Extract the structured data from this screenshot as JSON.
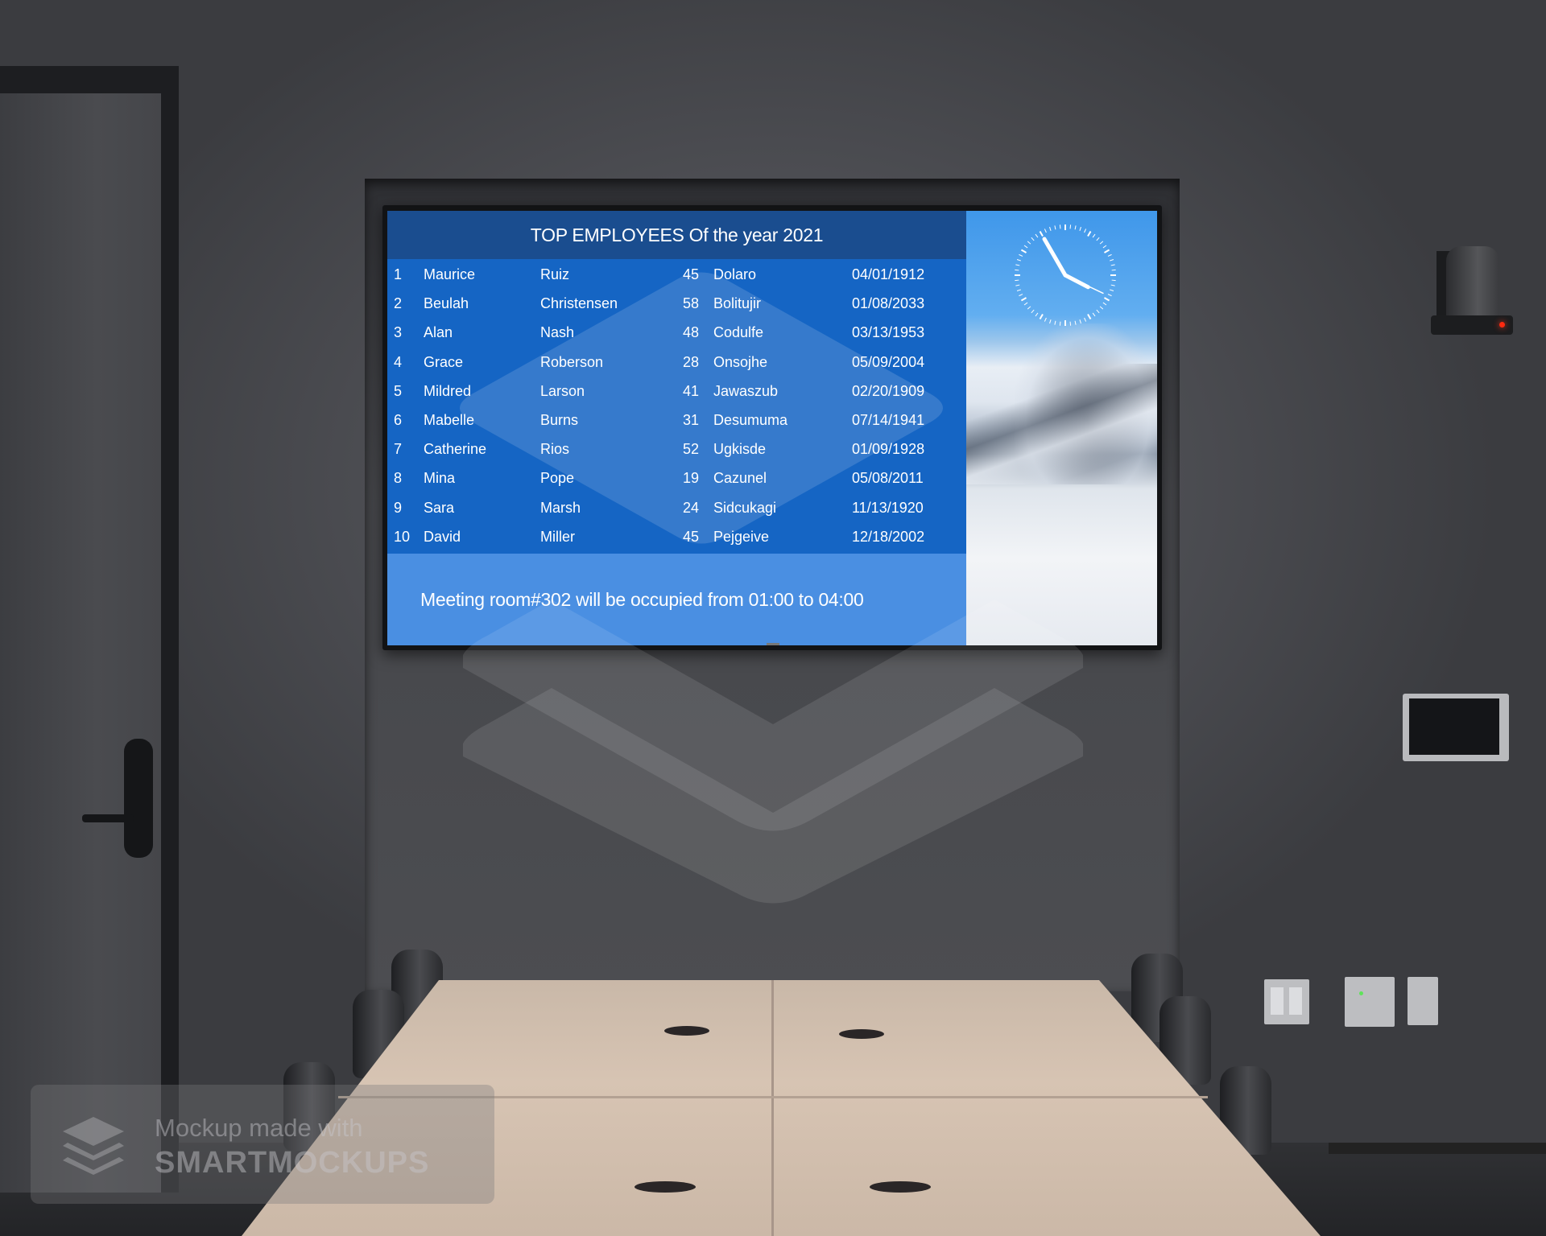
{
  "screen": {
    "title": "TOP EMPLOYEES Of the year 2021",
    "employees": [
      {
        "rank": "1",
        "first": "Maurice",
        "last": "Ruiz",
        "age": "45",
        "city": "Dolaro",
        "date": "04/01/1912"
      },
      {
        "rank": "2",
        "first": "Beulah",
        "last": "Christensen",
        "age": "58",
        "city": "Bolitujir",
        "date": "01/08/2033"
      },
      {
        "rank": "3",
        "first": "Alan",
        "last": "Nash",
        "age": "48",
        "city": "Codulfe",
        "date": "03/13/1953"
      },
      {
        "rank": "4",
        "first": "Grace",
        "last": "Roberson",
        "age": "28",
        "city": "Onsojhe",
        "date": "05/09/2004"
      },
      {
        "rank": "5",
        "first": "Mildred",
        "last": "Larson",
        "age": "41",
        "city": "Jawaszub",
        "date": "02/20/1909"
      },
      {
        "rank": "6",
        "first": "Mabelle",
        "last": "Burns",
        "age": "31",
        "city": "Desumuma",
        "date": "07/14/1941"
      },
      {
        "rank": "7",
        "first": "Catherine",
        "last": "Rios",
        "age": "52",
        "city": "Ugkisde",
        "date": "01/09/1928"
      },
      {
        "rank": "8",
        "first": "Mina",
        "last": "Pope",
        "age": "19",
        "city": "Cazunel",
        "date": "05/08/2011"
      },
      {
        "rank": "9",
        "first": "Sara",
        "last": "Marsh",
        "age": "24",
        "city": "Sidcukagi",
        "date": "11/13/1920"
      },
      {
        "rank": "10",
        "first": "David",
        "last": "Miller",
        "age": "45",
        "city": "Pejgeive",
        "date": "12/18/2002"
      }
    ],
    "banner": "Meeting room#302 will be occupied from 01:00 to 04:00",
    "clock": {
      "hour": 3,
      "minute": 55,
      "second": 20
    },
    "colors": {
      "header": "#1a4d8f",
      "table": "#1565c4",
      "banner": "#4a8fe2"
    },
    "side_image": "snowy-mountain-photo"
  },
  "watermark": {
    "line1": "Mockup made with",
    "line2": "SMARTMOCKUPS",
    "icon": "layers-icon"
  }
}
